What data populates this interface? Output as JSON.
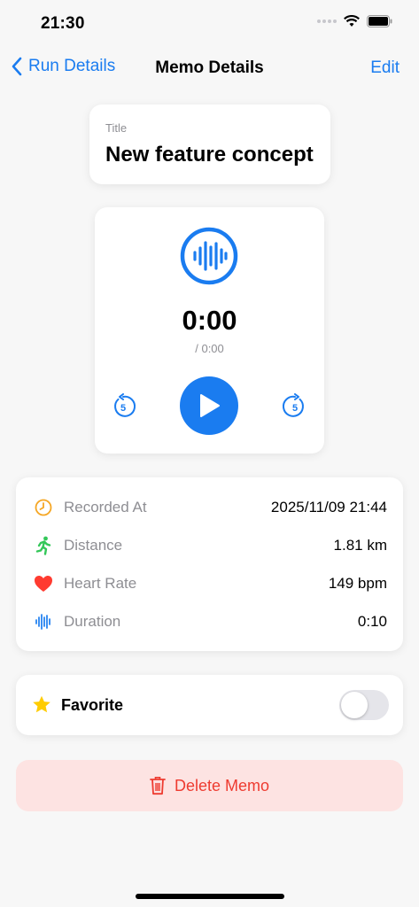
{
  "status_bar": {
    "time": "21:30"
  },
  "nav": {
    "back_label": "Run Details",
    "title": "Memo Details",
    "edit_label": "Edit"
  },
  "memo": {
    "title_label": "Title",
    "title": "New feature concept"
  },
  "player": {
    "elapsed": "0:00",
    "total": "/ 0:00",
    "skip_back_seconds": "5",
    "skip_forward_seconds": "5"
  },
  "info": {
    "rows": [
      {
        "icon": "clock-icon",
        "label": "Recorded At",
        "value": "2025/11/09 21:44",
        "color": "#f5a623"
      },
      {
        "icon": "running-icon",
        "label": "Distance",
        "value": "1.81 km",
        "color": "#34c759"
      },
      {
        "icon": "heart-icon",
        "label": "Heart Rate",
        "value": "149 bpm",
        "color": "#ff3b30"
      },
      {
        "icon": "waveform-icon",
        "label": "Duration",
        "value": "0:10",
        "color": "#1a7cf0"
      }
    ]
  },
  "favorite": {
    "label": "Favorite",
    "enabled": false
  },
  "delete": {
    "label": "Delete Memo"
  },
  "colors": {
    "accent": "#1a7cf0",
    "danger": "#ee3b30",
    "danger_bg": "#fde3e2"
  }
}
